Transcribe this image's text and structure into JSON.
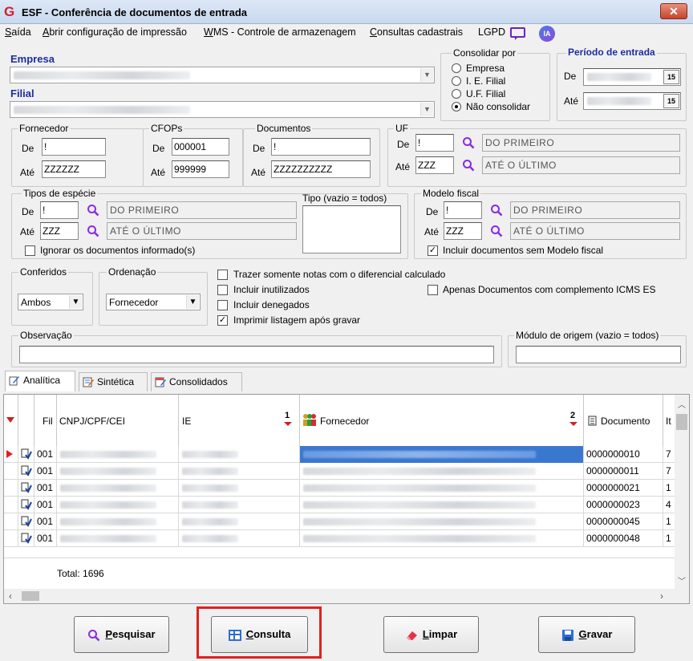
{
  "window": {
    "title": "ESF - Conferência de documentos de entrada",
    "close": "✕"
  },
  "menu": {
    "items": [
      {
        "u": "S",
        "rest": "aída"
      },
      {
        "u": "A",
        "rest": "brir configuração de impressão"
      },
      {
        "u": "W",
        "rest": "MS - Controle de armazenagem"
      },
      {
        "u": "C",
        "rest": "onsultas cadastrais"
      },
      {
        "u": "",
        "rest": "LGPD"
      }
    ],
    "ia": "IA"
  },
  "empresa": {
    "label": "Empresa"
  },
  "filial": {
    "label": "Filial"
  },
  "consolidar": {
    "legend": "Consolidar por",
    "options": [
      "Empresa",
      "I. E. Filial",
      "U.F. Filial",
      "Não consolidar"
    ],
    "selected": "Não consolidar"
  },
  "periodo": {
    "legend": "Período de entrada",
    "de": "De",
    "ate": "Até",
    "btn": "15"
  },
  "fornecedor": {
    "legend": "Fornecedor",
    "de_label": "De",
    "de": "!",
    "ate_label": "Até",
    "ate": "ZZZZZZ"
  },
  "cfops": {
    "legend": "CFOPs",
    "de_label": "De",
    "de": "000001",
    "ate_label": "Até",
    "ate": "999999"
  },
  "documentos": {
    "legend": "Documentos",
    "de_label": "De",
    "de": "!",
    "ate_label": "Até",
    "ate": "ZZZZZZZZZZ"
  },
  "uf": {
    "legend": "UF",
    "de_label": "De",
    "de": "!",
    "de_desc": "DO PRIMEIRO",
    "ate_label": "Até",
    "ate": "ZZZ",
    "ate_desc": "ATÉ O ÚLTIMO"
  },
  "especie": {
    "legend": "Tipos de espécie",
    "de_label": "De",
    "de": "!",
    "de_desc": "DO PRIMEIRO",
    "ate_label": "Até",
    "ate": "ZZZ",
    "ate_desc": "ATÉ O ÚLTIMO",
    "ignorar": "Ignorar os documentos informado(s)"
  },
  "tipo": {
    "legend": "Tipo (vazio = todos)"
  },
  "modelo": {
    "legend": "Modelo fiscal",
    "de_label": "De",
    "de": "!",
    "de_desc": "DO PRIMEIRO",
    "ate_label": "Até",
    "ate": "ZZZ",
    "ate_desc": "ATÉ O ÚLTIMO",
    "incluir": "Incluir documentos sem Modelo fiscal",
    "incluir_checked": true
  },
  "conferidos": {
    "legend": "Conferidos",
    "value": "Ambos"
  },
  "ordenacao": {
    "legend": "Ordenação",
    "value": "Fornecedor"
  },
  "opcoes": [
    {
      "label": "Trazer somente notas com o diferencial calculado",
      "checked": false
    },
    {
      "label": "Incluir inutilizados",
      "checked": false
    },
    {
      "label": "Incluir denegados",
      "checked": false
    },
    {
      "label": "Imprimir listagem após gravar",
      "checked": true
    }
  ],
  "apenas": {
    "label": "Apenas Documentos com complemento ICMS ES",
    "checked": false
  },
  "observacao": {
    "legend": "Observação",
    "value": ""
  },
  "modulo": {
    "legend": "Módulo de origem (vazio = todos)",
    "value": ""
  },
  "tabs": [
    {
      "label": "Analítica",
      "active": true
    },
    {
      "label": "Sintética",
      "active": false
    },
    {
      "label": "Consolidados",
      "active": false
    }
  ],
  "grid": {
    "columns": {
      "fil": "Fil",
      "cnpj": "CNPJ/CPF/CEI",
      "ie": "IE",
      "ie_sort": "1",
      "fornecedor": "Fornecedor",
      "forn_sort": "2",
      "documento": "Documento",
      "it": "It"
    },
    "rows": [
      {
        "fil": "001",
        "doc": "0000000010",
        "it": "7"
      },
      {
        "fil": "001",
        "doc": "0000000011",
        "it": "7"
      },
      {
        "fil": "001",
        "doc": "0000000021",
        "it": "1"
      },
      {
        "fil": "001",
        "doc": "0000000023",
        "it": "4"
      },
      {
        "fil": "001",
        "doc": "0000000045",
        "it": "1"
      },
      {
        "fil": "001",
        "doc": "0000000048",
        "it": "1"
      }
    ],
    "total": "Total: 1696"
  },
  "buttons": {
    "pesquisar": {
      "u": "P",
      "rest": "esquisar"
    },
    "consulta": {
      "u": "C",
      "rest": "onsulta"
    },
    "limpar": {
      "u": "L",
      "rest": "impar"
    },
    "gravar": {
      "u": "G",
      "rest": "ravar"
    }
  },
  "colors": {
    "highlight_box": "#e02020",
    "header_label": "#1d2e9e",
    "search_icon": "#8a2be2"
  }
}
